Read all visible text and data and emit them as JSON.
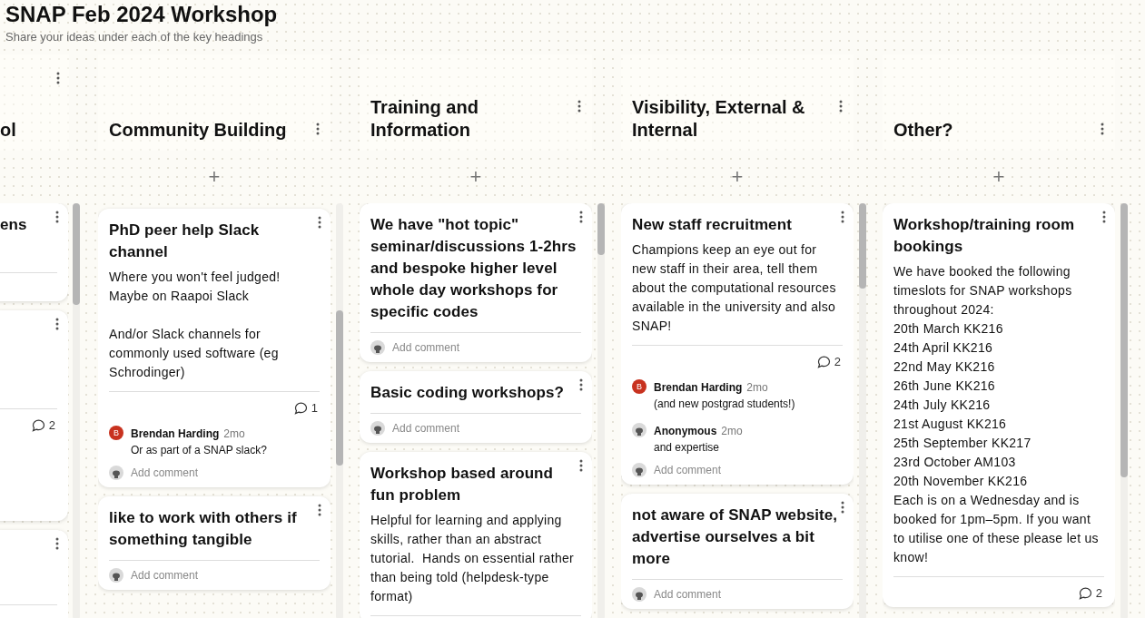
{
  "board": {
    "title": "SNAP Feb 2024 Workshop",
    "subtitle": "Share your ideas under each of the key headings"
  },
  "columns": [
    {
      "kind": "partial",
      "title": "ol",
      "cards": [
        {
          "kind": "post",
          "title": "ens"
        },
        {
          "kind": "post",
          "comment_count": "2"
        },
        {
          "kind": "post"
        }
      ]
    },
    {
      "kind": "full",
      "title": "Community Building",
      "add_button": "+",
      "cards": [
        {
          "kind": "sliver"
        },
        {
          "title": "PhD peer help Slack channel",
          "body": "Where you won't feel judged!\nMaybe on Raapoi Slack\n\nAnd/or Slack channels for commonly used software (eg Schrodinger)",
          "comment_count": "1",
          "comments": [
            {
              "kind": "initial",
              "initial": "B",
              "author": "Brendan Harding",
              "time": "2mo",
              "text": "Or as part of a SNAP slack?"
            }
          ],
          "add_comment": "Add comment"
        },
        {
          "title": "like to work with others if something tangible",
          "add_comment": "Add comment"
        }
      ]
    },
    {
      "kind": "full",
      "title": "Training and Information",
      "add_button": "+",
      "cards": [
        {
          "title": "We have \"hot topic\" seminar/discussions 1-2hrs and bespoke higher level whole day workshops for specific codes",
          "add_comment": "Add comment"
        },
        {
          "title": "Basic coding workshops?",
          "add_comment": "Add comment"
        },
        {
          "title": "Workshop based around fun problem",
          "body": "Helpful for learning and applying skills, rather than an abstract tutorial.  Hands on essential rather than being told (helpdesk-type format)"
        }
      ]
    },
    {
      "kind": "full",
      "title": "Visibility, External & Internal",
      "add_button": "+",
      "cards": [
        {
          "title": "New staff recruitment",
          "body": "Champions keep an eye out for new staff in their area, tell them about the computational resources available in the university and also SNAP!",
          "comment_count": "2",
          "comments": [
            {
              "kind": "initial",
              "initial": "B",
              "author": "Brendan Harding",
              "time": "2mo",
              "text": "(and new postgrad students!)"
            },
            {
              "kind": "anonymous",
              "author": "Anonymous",
              "time": "2mo",
              "text": "and expertise"
            }
          ],
          "add_comment": "Add comment"
        },
        {
          "title": "not aware of SNAP website, advertise ourselves a bit more",
          "add_comment": "Add comment"
        }
      ]
    },
    {
      "kind": "full",
      "title": "Other?",
      "add_button": "+",
      "cards": [
        {
          "title": "Workshop/training room bookings",
          "body": "We have booked the following timeslots for SNAP workshops throughout 2024:\n20th March KK216\n24th April KK216\n22nd May KK216\n26th June KK216\n24th July KK216\n21st August KK216\n25th September KK217\n23rd October AM103\n20th November KK216\nEach is on a Wednesday and is booked for 1pm–5pm. If you want to utilise one of these please let us know!",
          "comment_count": "2"
        }
      ]
    }
  ]
}
